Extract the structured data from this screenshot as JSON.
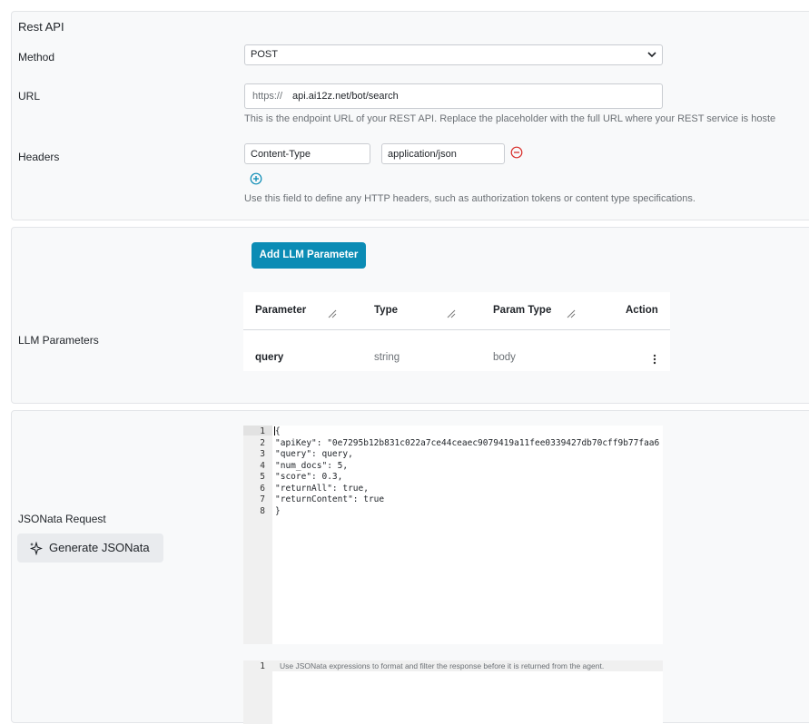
{
  "rest_api": {
    "title": "Rest API",
    "method_label": "Method",
    "method_value": "POST",
    "url_label": "URL",
    "url_prefix": "https://",
    "url_value": "api.ai12z.net/bot/search",
    "url_help": "This is the endpoint URL of your REST API. Replace the placeholder with the full URL where your REST service is hoste",
    "headers_label": "Headers",
    "header_key": "Content-Type",
    "header_value": "application/json",
    "headers_help": "Use this field to define any HTTP headers, such as authorization tokens or content type specifications."
  },
  "llm": {
    "label": "LLM Parameters",
    "add_button": "Add LLM Parameter",
    "columns": [
      "Parameter",
      "Type",
      "Param Type",
      "Action"
    ],
    "rows": [
      {
        "parameter": "query",
        "type": "string",
        "param_type": "body"
      }
    ]
  },
  "jsonata": {
    "label": "JSONata Request",
    "generate_button": "Generate JSONata",
    "request_lines": [
      {
        "n": "1",
        "code": "{"
      },
      {
        "n": "2",
        "code": "\"apiKey\": \"0e7295b12b831c022a7ce44ceaec9079419a11fee0339427db70cff9b77faa6"
      },
      {
        "n": "3",
        "code": "\"query\": query,"
      },
      {
        "n": "4",
        "code": "\"num_docs\": 5,"
      },
      {
        "n": "5",
        "code": "\"score\": 0.3,"
      },
      {
        "n": "6",
        "code": "\"returnAll\": true,"
      },
      {
        "n": "7",
        "code": "\"returnContent\": true"
      },
      {
        "n": "8",
        "code": "}"
      }
    ],
    "response_line_number": "1",
    "response_placeholder": "Use JSONata expressions to format and filter the response before it is returned from the agent."
  },
  "colors": {
    "accent": "#0b8cb5",
    "remove": "#d9302c",
    "add": "#0b8cb5"
  }
}
